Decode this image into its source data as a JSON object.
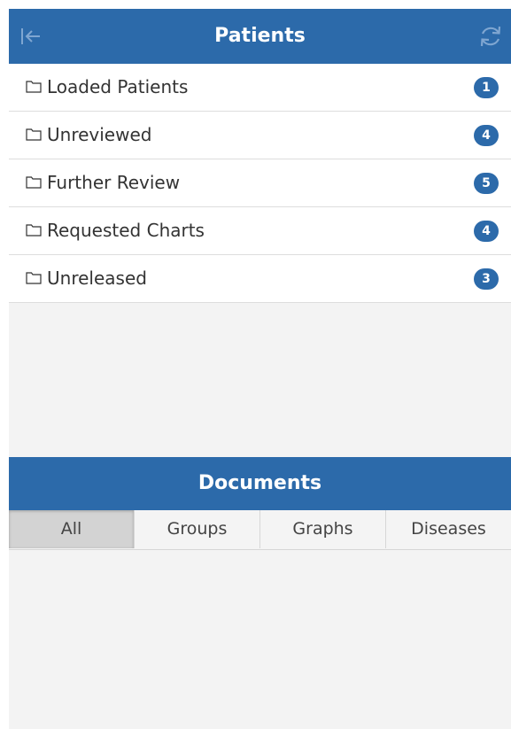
{
  "header": {
    "title": "Patients",
    "back_icon": "arrow-left-to-bar-icon",
    "refresh_icon": "refresh-icon"
  },
  "folders": [
    {
      "label": "Loaded Patients",
      "count": "1"
    },
    {
      "label": "Unreviewed",
      "count": "4"
    },
    {
      "label": "Further Review",
      "count": "5"
    },
    {
      "label": "Requested Charts",
      "count": "4"
    },
    {
      "label": "Unreleased",
      "count": "3"
    }
  ],
  "documents": {
    "title": "Documents",
    "tabs": [
      {
        "label": "All",
        "active": true
      },
      {
        "label": "Groups",
        "active": false
      },
      {
        "label": "Graphs",
        "active": false
      },
      {
        "label": "Diseases",
        "active": false
      }
    ]
  },
  "colors": {
    "header_bg": "#2c6aaa",
    "badge_bg": "#2c6aaa",
    "panel_bg": "#f3f3f3"
  }
}
